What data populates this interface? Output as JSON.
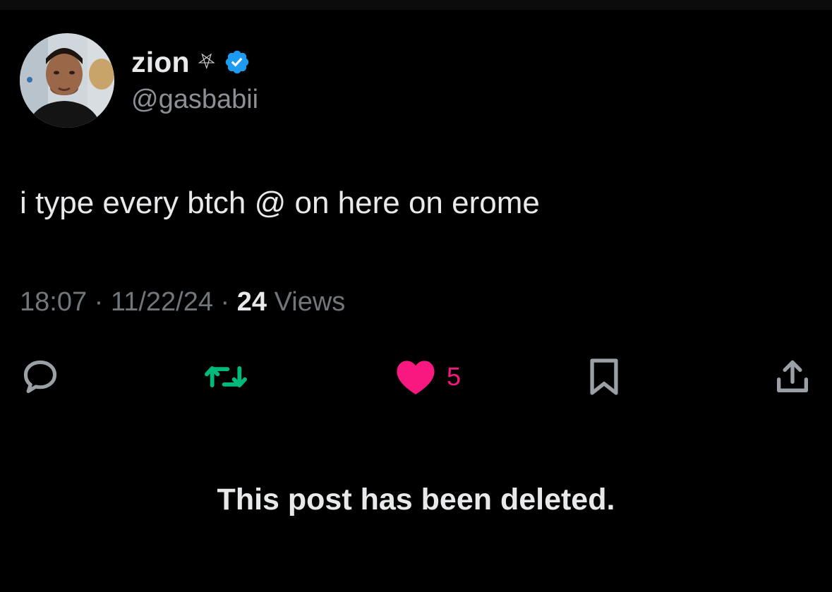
{
  "author": {
    "display_name": "zion",
    "name_emoji": "⛧",
    "handle": "@gasbabii",
    "verified": true
  },
  "post": {
    "text": "i type every btch @ on here on erome",
    "time": "18:07",
    "separator": "·",
    "date": "11/22/24",
    "views_count": "24",
    "views_label": "Views"
  },
  "actions": {
    "reply_icon": "reply-bubble-icon",
    "retweet_icon": "retweet-icon",
    "like_icon": "heart-filled-icon",
    "like_count": "5",
    "bookmark_icon": "bookmark-icon",
    "share_icon": "share-upload-icon"
  },
  "status": {
    "deleted_message": "This post has been deleted."
  },
  "colors": {
    "background": "#000000",
    "text_primary": "#e7e9ea",
    "text_secondary": "#71767b",
    "verified_blue": "#1d9bf0",
    "retweet_green": "#00ba7c",
    "like_pink": "#f91880"
  }
}
